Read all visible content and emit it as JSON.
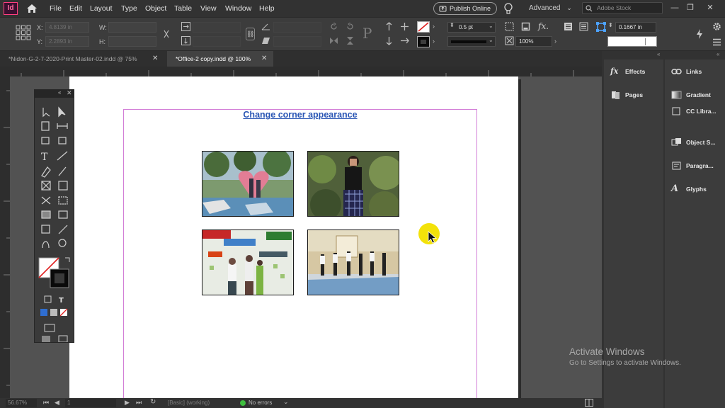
{
  "app": {
    "logo_text": "Id"
  },
  "menu": [
    "File",
    "Edit",
    "Layout",
    "Type",
    "Object",
    "Table",
    "View",
    "Window",
    "Help"
  ],
  "header": {
    "publish_label": "Publish Online",
    "workspace_label": "Advanced",
    "search_placeholder": "Adobe Stock"
  },
  "control": {
    "x_label": "X:",
    "y_label": "Y:",
    "w_label": "W:",
    "h_label": "H:",
    "x_value": "4.8139 in",
    "y_value": "2.2893 in",
    "stroke_weight": "0.5 pt",
    "scale_percent": "100%",
    "offset_value": "0.1667 in",
    "stroke_color": "#000000"
  },
  "tabs": [
    {
      "label": "*Nidon-G-2-7-2020-Print Master-02.indd @ 75%",
      "active": false
    },
    {
      "label": "*Office-2 copy.indd @ 100%",
      "active": true
    }
  ],
  "document": {
    "heading": "Change corner appearance",
    "photos": [
      {
        "name": "photo-heart-garden",
        "description_icon": "image-icon"
      },
      {
        "name": "photo-person-plants",
        "description_icon": "image-icon"
      },
      {
        "name": "photo-barcamp-banner",
        "description_icon": "image-icon"
      },
      {
        "name": "photo-hall-group",
        "description_icon": "image-icon"
      }
    ]
  },
  "status": {
    "zoom": "56.67%",
    "page": "1",
    "preflight_profile": "[Basic] (working)",
    "errors": "No errors"
  },
  "panels": {
    "left_column": [
      {
        "label": "Effects",
        "icon": "fx-icon"
      },
      {
        "label": "Pages",
        "icon": "pages-icon"
      }
    ],
    "right_column": [
      {
        "label": "Links",
        "icon": "links-icon"
      },
      {
        "label": "Gradient",
        "icon": "gradient-icon"
      },
      {
        "label": "CC Libra...",
        "icon": "cc-libraries-icon"
      },
      {
        "label": "Object S...",
        "icon": "object-styles-icon"
      },
      {
        "label": "Paragra...",
        "icon": "paragraph-styles-icon"
      },
      {
        "label": "Glyphs",
        "icon": "glyphs-icon"
      }
    ]
  },
  "watermark": {
    "title": "Activate Windows",
    "subtitle": "Go to Settings to activate Windows."
  },
  "colors": {
    "frame_edge": "#d37fd7",
    "heading": "#2b57b5",
    "cursor_highlight": "#f3e20a",
    "app_accent": "#ff3f7f"
  }
}
